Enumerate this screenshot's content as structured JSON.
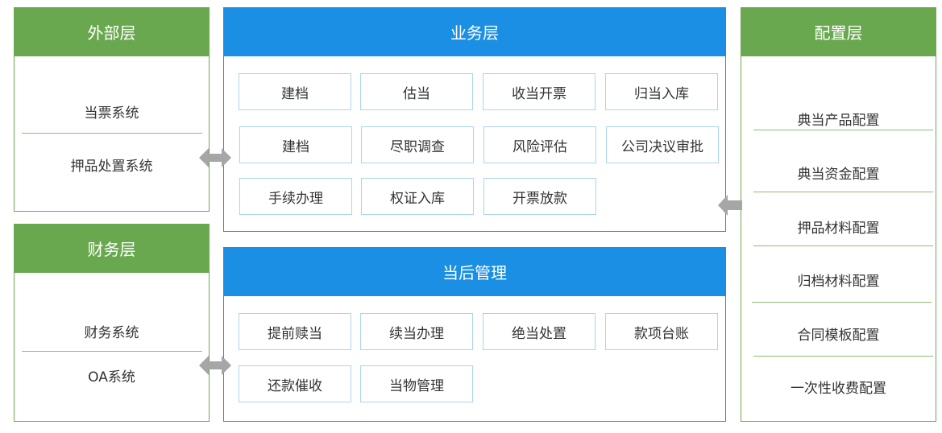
{
  "external": {
    "title": "外部层",
    "items": [
      "当票系统",
      "押品处置系统"
    ]
  },
  "finance": {
    "title": "财务层",
    "items": [
      "财务系统",
      "OA系统"
    ]
  },
  "business": {
    "title": "业务层",
    "rows": [
      [
        "建档",
        "估当",
        "收当开票",
        "归当入库"
      ],
      [
        "建档",
        "尽职调查",
        "风险评估",
        "公司决议审批"
      ],
      [
        "手续办理",
        "权证入库",
        "开票放款"
      ]
    ]
  },
  "post": {
    "title": "当后管理",
    "rows": [
      [
        "提前赎当",
        "续当办理",
        "绝当处置",
        "款项台账"
      ],
      [
        "还款催收",
        "当物管理"
      ]
    ]
  },
  "config": {
    "title": "配置层",
    "items": [
      "典当产品配置",
      "典当资金配置",
      "押品材料配置",
      "归档材料配置",
      "合同模板配置",
      "一次性收费配置"
    ]
  },
  "colors": {
    "green": "#6aa84f",
    "blue": "#1a8fe3",
    "box_border": "#a9d6ee",
    "arrow": "#a6a6a6"
  }
}
